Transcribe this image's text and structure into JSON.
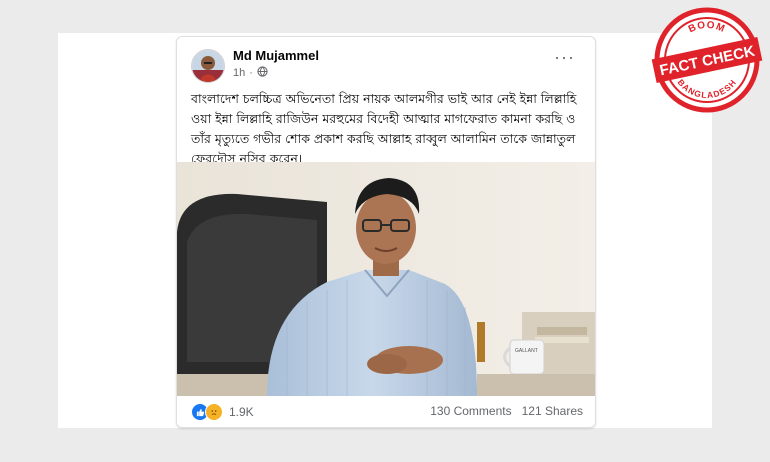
{
  "post": {
    "author": "Md Mujammel",
    "time": "1h",
    "privacy_icon": "globe-icon",
    "more_label": "···",
    "text": "বাংলাদেশ চলচ্চিত্র অভিনেতা প্রিয় নায়ক আলমগীর ভাই আর নেই ইন্না লিল্লাহি ওয়া ইন্না লিল্লাহি রাজিউন মরহুমের বিদেহী আত্মার মাগফেরাত কামনা করছি ও তাঁর মৃত্যুতে গভীর শোক প্রকাশ করছি আল্লাহ রাব্বুল আলামিন তাকে জান্নাতুল ফেরদৌস নসিব করেন।",
    "mug_text": "GALLANT",
    "reaction_count": "1.9K",
    "comments": "130 Comments",
    "shares": "121 Shares"
  },
  "stamp": {
    "top": "BOOM",
    "main": "FACT CHECK",
    "bottom": "BANGLADESH",
    "color": "#e0232b"
  },
  "colors": {
    "like": "#1877f2",
    "sad": "#f7b125",
    "background": "#ebebeb"
  }
}
